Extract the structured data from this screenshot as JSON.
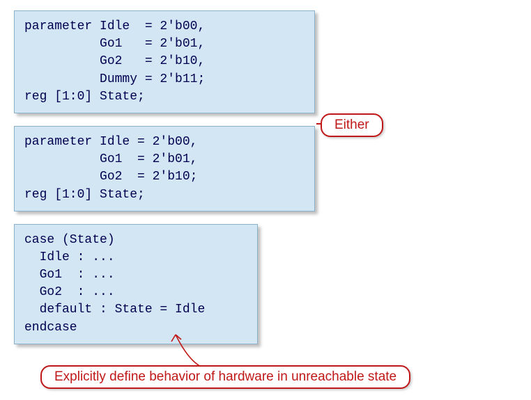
{
  "block1": "parameter Idle  = 2'b00,\n          Go1   = 2'b01,\n          Go2   = 2'b10,\n          Dummy = 2'b11;\nreg [1:0] State;",
  "block2": "parameter Idle = 2'b00,\n          Go1  = 2'b01,\n          Go2  = 2'b10;\nreg [1:0] State;",
  "block3": "case (State)\n  Idle : ...\n  Go1  : ...\n  Go2  : ...\n  default : State = Idle\nendcase",
  "callout_either": "Either",
  "callout_explain": "Explicitly define behavior of hardware in unreachable state"
}
